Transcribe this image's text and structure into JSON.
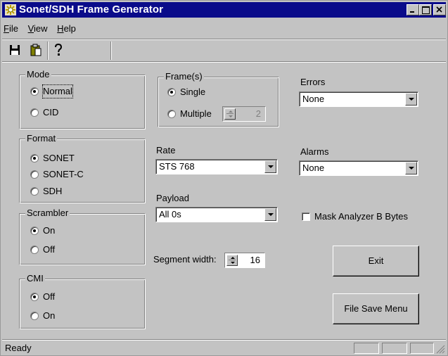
{
  "window": {
    "title": "Sonet/SDH Frame Generator"
  },
  "menu": [
    {
      "key": "F",
      "rest": "ile"
    },
    {
      "key": "V",
      "rest": "iew"
    },
    {
      "key": "H",
      "rest": "elp"
    }
  ],
  "toolbar": {
    "icons": [
      "save-icon",
      "clipboard-icon",
      "help-icon"
    ]
  },
  "mode": {
    "label": "Mode",
    "options": [
      "Normal",
      "CID"
    ],
    "selected": "Normal"
  },
  "format": {
    "label": "Format",
    "options": [
      "SONET",
      "SONET-C",
      "SDH"
    ],
    "selected": "SONET"
  },
  "scrambler": {
    "label": "Scrambler",
    "options": [
      "On",
      "Off"
    ],
    "selected": "On"
  },
  "cmi": {
    "label": "CMI",
    "options": [
      "Off",
      "On"
    ],
    "selected": "Off"
  },
  "frames": {
    "label": "Frame(s)",
    "options": [
      "Single",
      "Multiple"
    ],
    "selected": "Single",
    "multiple_count": "2"
  },
  "rate": {
    "label": "Rate",
    "value": "STS 768"
  },
  "payload": {
    "label": "Payload",
    "value": "All 0s"
  },
  "segment": {
    "label": "Segment width:",
    "value": "16"
  },
  "errors": {
    "label": "Errors",
    "value": "None"
  },
  "alarms": {
    "label": "Alarms",
    "value": "None"
  },
  "mask": {
    "label": "Mask Analyzer B Bytes",
    "checked": false
  },
  "buttons": {
    "exit": "Exit",
    "file_save": "File Save Menu"
  },
  "status": {
    "text": "Ready"
  }
}
